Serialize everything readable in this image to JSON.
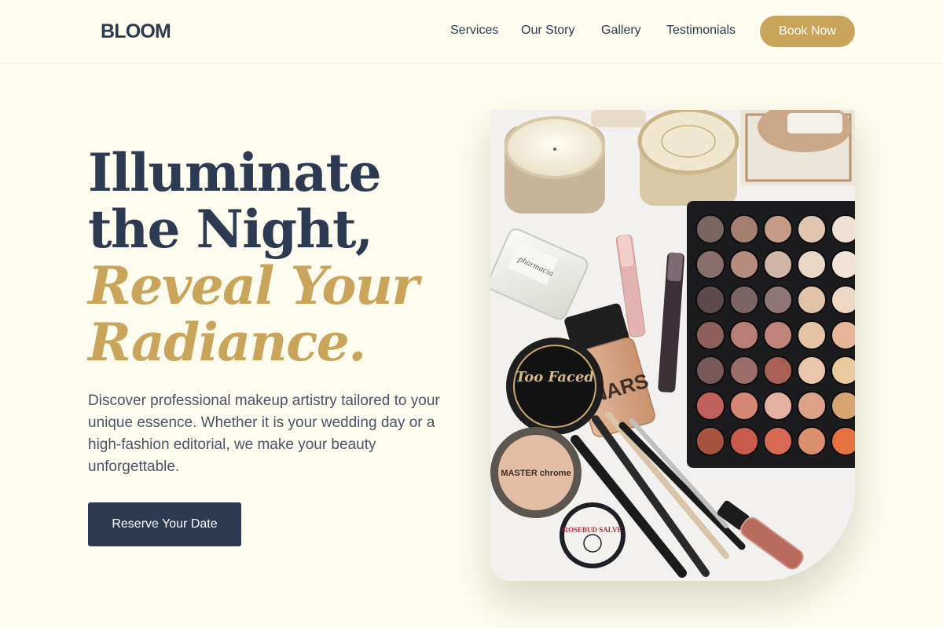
{
  "brand": {
    "name": "BLOOM"
  },
  "nav": {
    "items": [
      "Services",
      "Our Story",
      "Gallery",
      "Testimonials"
    ],
    "cta": "Book Now"
  },
  "hero": {
    "headline_line1": "Illuminate",
    "headline_line2": "the Night,",
    "headline_line3": "Reveal Your",
    "headline_line4": "Radiance.",
    "intro": "Discover professional makeup artistry tailored to your unique essence. Whether it is your wedding day or a high-fashion editorial, we make your beauty unforgettable.",
    "cta": "Reserve Your Date",
    "image": {
      "subject": "flat-lay of makeup products: eyeshadow palette, candles, foundation bottle, brushes, compact powders, lip gloss",
      "product_labels": [
        "Too Faced",
        "NARS",
        "MASTER chrome",
        "ROSEBUD SALVE",
        "pharmacia"
      ]
    }
  },
  "colors": {
    "background": "#fdfcee",
    "navy": "#2c3a52",
    "gold": "#c9a55b",
    "body_text": "#4a5468"
  }
}
